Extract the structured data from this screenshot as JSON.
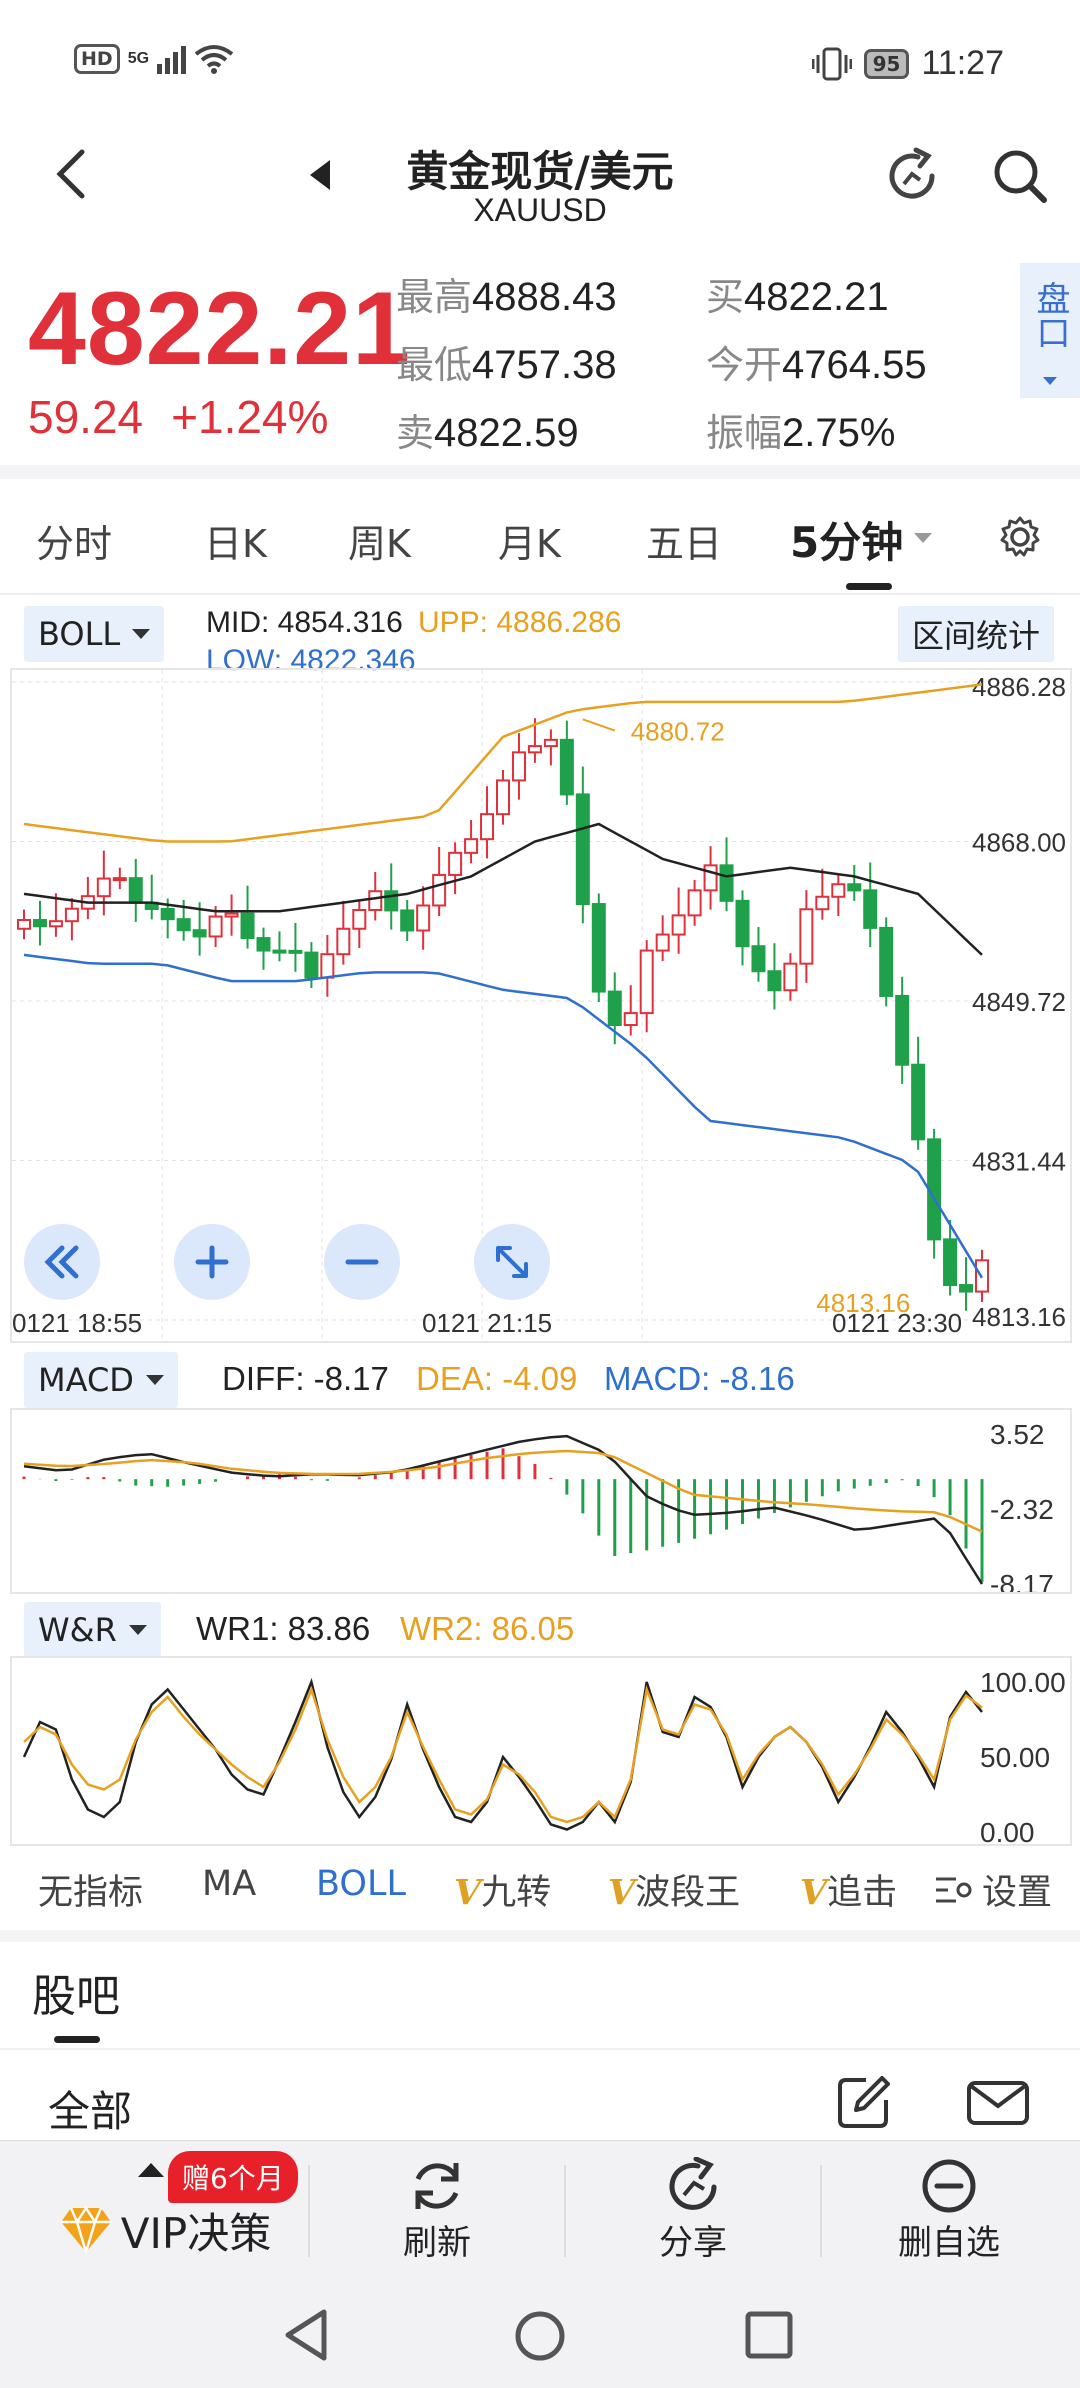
{
  "status_bar": {
    "left_badge": "HD",
    "net": "5G",
    "battery": "95",
    "time": "11:27"
  },
  "header": {
    "title": "黄金现货/美元",
    "subtitle": "XAUUSD"
  },
  "quote": {
    "price": "4822.21",
    "change": "59.24",
    "change_pct": "+1.24%",
    "high_label": "最高",
    "high": "4888.43",
    "low_label": "最低",
    "low": "4757.38",
    "sell_label": "卖",
    "sell": "4822.59",
    "buy_label": "买",
    "buy": "4822.21",
    "open_label": "今开",
    "open": "4764.55",
    "amp_label": "振幅",
    "amp": "2.75%",
    "pankou": "盘口"
  },
  "tabs": [
    "分时",
    "日K",
    "周K",
    "月K",
    "五日",
    "5分钟"
  ],
  "boll": {
    "label": "BOLL",
    "mid": "MID: 4854.316",
    "upp": "UPP: 4886.286",
    "low": "LOW: 4822.346",
    "range_btn": "区间统计",
    "y_ticks": [
      "4886.28",
      "4868.00",
      "4849.72",
      "4831.44",
      "4813.16"
    ],
    "x_ticks": [
      "0121  18:55",
      "0121  21:15",
      "0121  23:30"
    ],
    "annot_high": "4880.72",
    "annot_low": "4813.16"
  },
  "macd": {
    "label": "MACD",
    "diff": "DIFF: -8.17",
    "dea": "DEA: -4.09",
    "macd": "MACD: -8.16",
    "y_ticks": [
      "3.52",
      "-2.32",
      "-8.17"
    ]
  },
  "wr": {
    "label": "W&R",
    "wr1": "WR1: 83.86",
    "wr2": "WR2: 86.05",
    "y_ticks": [
      "100.00",
      "50.00",
      "0.00"
    ]
  },
  "indicator_tabs": {
    "none": "无指标",
    "ma": "MA",
    "boll": "BOLL",
    "jiuzhuan": "九转",
    "boduan": "波段王",
    "zhuiji": "追击",
    "settings": "设置",
    "v": "V"
  },
  "guba": {
    "title": "股吧",
    "all": "全部"
  },
  "bottom_bar": {
    "vip": "VIP决策",
    "badge": "赠6个月",
    "refresh": "刷新",
    "share": "分享",
    "delete": "删自选"
  },
  "colors": {
    "red": "#e0303a",
    "green": "#1fa14a",
    "orange": "#e8a020",
    "blue": "#2f6fd0"
  },
  "chart_data": [
    {
      "type": "candlestick",
      "title": "",
      "ylim": [
        4813.16,
        4886.28
      ],
      "ymarks": [
        4886.28,
        4868.0,
        4849.72,
        4831.44,
        4813.16
      ],
      "annotations": [
        4880.72,
        4813.16
      ],
      "overlays": [
        "MID",
        "UPP",
        "LOW"
      ]
    },
    {
      "type": "bar",
      "title": "",
      "series": [
        {
          "name": "DIFF",
          "last": -8.17
        },
        {
          "name": "DEA",
          "last": -4.09
        },
        {
          "name": "MACD",
          "last": -8.16
        }
      ],
      "ylim": [
        -8.17,
        3.52
      ]
    },
    {
      "type": "line",
      "title": "",
      "series": [
        {
          "name": "WR1",
          "last": 83.86
        },
        {
          "name": "WR2",
          "last": 86.05
        }
      ],
      "ylim": [
        0,
        100
      ]
    }
  ]
}
